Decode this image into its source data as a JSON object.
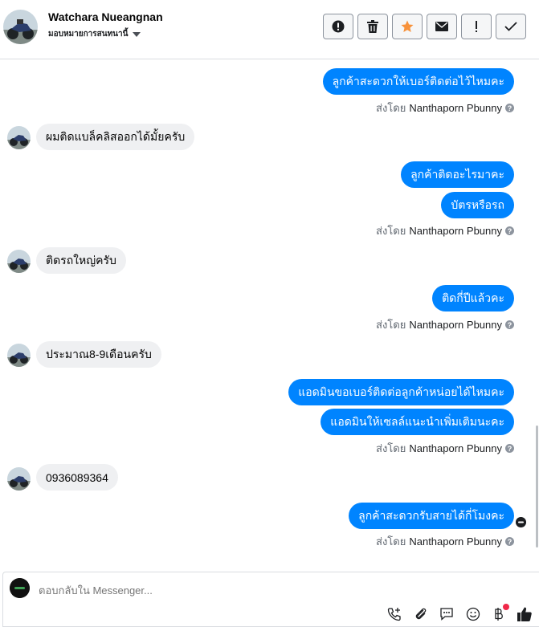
{
  "header": {
    "contact_name": "Watchara Nueangnan",
    "assign_label": "มอบหมายการสนทนานี้"
  },
  "toolbar": {
    "icons": [
      "alert-circle-icon",
      "trash-icon",
      "star-icon",
      "envelope-icon",
      "exclamation-icon",
      "check-icon"
    ],
    "star_color": "#f7923b"
  },
  "messages": [
    {
      "dir": "out",
      "text": "ลูกค้าสะดวกให้เบอร์ติดต่อไว้ไหมคะ"
    },
    {
      "dir": "in",
      "text": "ผมติดแบล็คลิสออกได้มั้ยครับ"
    },
    {
      "dir": "out",
      "text": "ลูกค้าติดอะไรมาคะ"
    },
    {
      "dir": "out",
      "text": "บัตรหรือรถ"
    },
    {
      "dir": "in",
      "text": "ติดรถใหญ่ครับ"
    },
    {
      "dir": "out",
      "text": "ติดกี่ปีแล้วคะ"
    },
    {
      "dir": "in",
      "text": "ประมาณ8-9เดือนครับ"
    },
    {
      "dir": "out",
      "text": "แอดมินขอเบอร์ติดต่อลูกค้าหน่อยได้ไหมคะ"
    },
    {
      "dir": "out",
      "text": "แอดมินให้เซลล์แนะนำเพิ่มเติมนะคะ"
    },
    {
      "dir": "in",
      "text": "0936089364"
    },
    {
      "dir": "out",
      "text": "ลูกค้าสะดวกรับสายได้กี่โมงคะ"
    }
  ],
  "sent_by": {
    "prefix": "ส่งโดย",
    "agent": "Nanthaporn Pbunny"
  },
  "composer": {
    "placeholder": "ตอบกลับใน Messenger..."
  },
  "colors": {
    "outgoing_bubble": "#0084ff",
    "incoming_bubble": "#eff0f2",
    "notification_dot": "#f02849"
  }
}
